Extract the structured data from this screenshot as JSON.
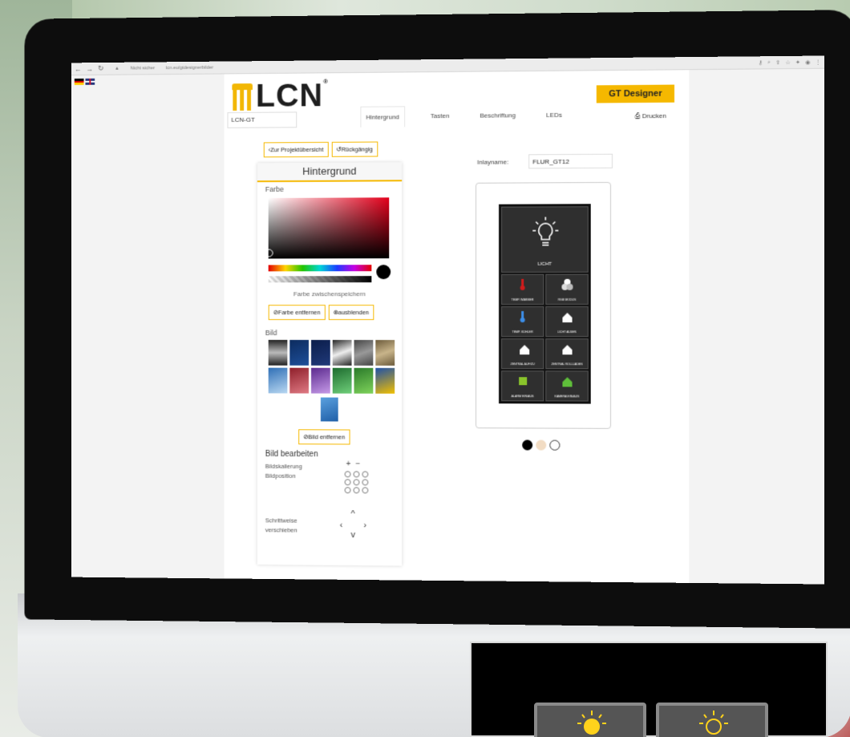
{
  "browser": {
    "security_label": "Nicht sicher",
    "url": "lcn.eu/gtdesignerbilder"
  },
  "header": {
    "logo_text": "LCN",
    "logo_reg": "®",
    "gt_designer_label": "GT Designer",
    "project_name": "LCN-GT",
    "print_label": "Drucken"
  },
  "tabs": [
    {
      "label": "Hintergrund",
      "active": true
    },
    {
      "label": "Tasten",
      "active": false
    },
    {
      "label": "Beschriftung",
      "active": false
    },
    {
      "label": "LEDs",
      "active": false
    }
  ],
  "toolbar": {
    "overview_label": "Zur Projektübersicht",
    "undo_label": "Rückgängig"
  },
  "panel": {
    "title": "Hintergrund",
    "color_label": "Farbe",
    "save_color_label": "Farbe zwischenspeichern",
    "remove_color_label": "Farbe entfernen",
    "hide_label": "ausblenden",
    "image_label": "Bild",
    "remove_image_label": "Bild entfernen",
    "edit_title": "Bild bearbeiten",
    "scaling_label": "Bildskalierung",
    "position_label": "Bildposition",
    "step_label_1": "Schrittweise",
    "step_label_2": "verschieben",
    "selected_color": "#000000",
    "hue_color": "#e3001b",
    "thumbnails": [
      "linear-gradient(180deg,#222,#bbb,#222)",
      "linear-gradient(160deg,#0c2b5e,#1e4f9a)",
      "linear-gradient(160deg,#0b1d4a,#203a7a)",
      "linear-gradient(160deg,#222,#eee 50%,#222)",
      "linear-gradient(160deg,#444,#999,#444)",
      "linear-gradient(160deg,#6b5a3a,#c8b48a,#6b5a3a)",
      "linear-gradient(160deg,#2f6fb6,#b9d8f2)",
      "linear-gradient(160deg,#8e1f2a,#e07a84)",
      "linear-gradient(160deg,#5b2a8e,#c69ae8)",
      "linear-gradient(160deg,#1d6b2e,#6fcf7a)",
      "linear-gradient(160deg,#2a7a2a,#7fd35b)",
      "linear-gradient(160deg,#1d4fa8,#f2c000)"
    ]
  },
  "inlay": {
    "label": "Inlayname:",
    "name": "FLUR_GT12",
    "big_key_label": "LICHT",
    "keys": [
      "TEMP. WÄRMER",
      "RGB MODUS",
      "TEMP. KÜHLER",
      "LICHT AUßEN",
      "ZENTRAL AUF/ZU",
      "ZENTRAL ROLLLÄDEN",
      "ALARM EIN/AUS",
      "KAMERA EIN/AUS"
    ],
    "frame_colors": [
      "#000000",
      "#f2dcc3",
      "#ffffff"
    ]
  },
  "colors": {
    "accent": "#f5b800"
  }
}
